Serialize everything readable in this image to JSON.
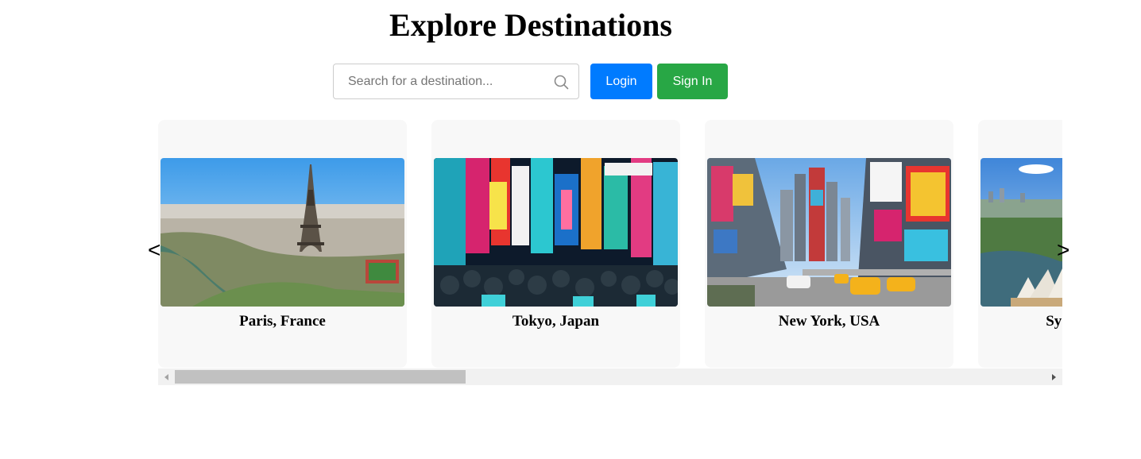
{
  "header": {
    "title": "Explore Destinations"
  },
  "search": {
    "placeholder": "Search for a destination...",
    "value": "",
    "icon": "search-icon"
  },
  "buttons": {
    "login_label": "Login",
    "signin_label": "Sign In"
  },
  "colors": {
    "login": "#007bff",
    "signin": "#28a745",
    "card_bg": "#f8f8f8"
  },
  "carousel": {
    "prev_label": "<",
    "next_label": ">",
    "cards": [
      {
        "label": "Paris, France",
        "image": "eiffel-tower-photo"
      },
      {
        "label": "Tokyo, Japan",
        "image": "tokyo-neon-street-photo"
      },
      {
        "label": "New York, USA",
        "image": "times-square-photo"
      },
      {
        "label": "Sydney, Australia",
        "image": "sydney-opera-house-photo"
      }
    ],
    "scroll_position": 0
  }
}
